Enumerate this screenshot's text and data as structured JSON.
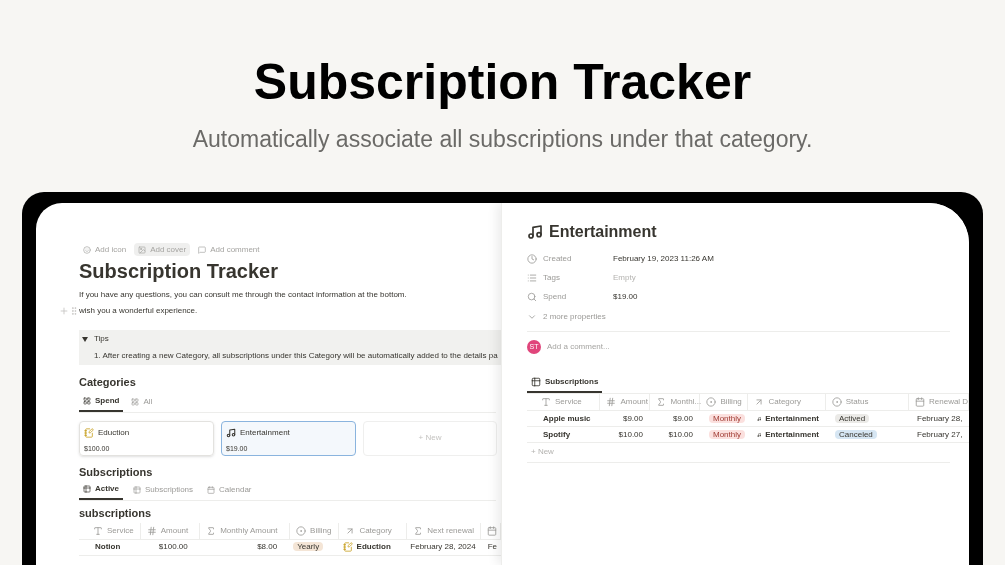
{
  "hero": {
    "title": "Subscription Tracker",
    "subtitle": "Automatically associate all subscriptions under that category."
  },
  "page": {
    "actions": [
      {
        "label": "Add icon",
        "kind": "icon",
        "selected": false
      },
      {
        "label": "Add cover",
        "kind": "cover",
        "selected": true
      },
      {
        "label": "Add comment",
        "kind": "comment",
        "selected": false
      }
    ],
    "title": "Subscription Tracker",
    "paragraphs": [
      "If you have any questions, you can consult me through the contact information at the bottom.",
      "wish you a wonderful experience."
    ],
    "toggle": {
      "label": "Tips",
      "expanded": true,
      "content": "1. After creating a new Category, all subscriptions under this Category will be automatically added to the details pa"
    },
    "categories": {
      "heading": "Categories",
      "views": [
        {
          "label": "Spend",
          "selected": true
        },
        {
          "label": "All",
          "selected": false
        }
      ],
      "cards": [
        {
          "name": "Eduction",
          "kind": "memo",
          "amount": "$100.00",
          "selected": false
        },
        {
          "name": "Entertainment",
          "kind": "music",
          "amount": "$19.00",
          "selected": true
        }
      ],
      "new_label": "+ New"
    },
    "subscriptions": {
      "heading": "Subscriptions",
      "views": [
        {
          "label": "Active",
          "kind": "table",
          "selected": true
        },
        {
          "label": "Subscriptions",
          "kind": "table",
          "selected": false
        },
        {
          "label": "Calendar",
          "kind": "calendar",
          "selected": false
        }
      ],
      "table_title": "subscriptions",
      "columns": [
        {
          "label": "Service",
          "kind": "text"
        },
        {
          "label": "Amount",
          "kind": "number"
        },
        {
          "label": "Monthly Amount",
          "kind": "formula"
        },
        {
          "label": "Billing",
          "kind": "select"
        },
        {
          "label": "Category",
          "kind": "relation"
        },
        {
          "label": "Next renewal",
          "kind": "formula"
        },
        {
          "kind": "date"
        }
      ],
      "rows": [
        {
          "service": "Notion",
          "amount": "$100.00",
          "monthly": "$8.00",
          "billing": {
            "label": "Yearly",
            "color": "#f4e5d6"
          },
          "category": {
            "name": "Eduction",
            "kind": "memo"
          },
          "next_renewal": "February 28, 2024",
          "column_7": "Fe"
        }
      ]
    }
  },
  "detail": {
    "kind": "music",
    "title": "Entertainment",
    "properties": [
      {
        "kind": "date",
        "name": "Created",
        "value": "February 19, 2023 11:26 AM",
        "empty": false
      },
      {
        "kind": "multi",
        "name": "Tags",
        "value": "Empty",
        "empty": true
      },
      {
        "kind": "rollup",
        "name": "Spend",
        "value": "$19.00",
        "empty": false
      }
    ],
    "more": "2 more properties",
    "comment": {
      "avatar": "ST",
      "placeholder": "Add a comment..."
    },
    "view": {
      "label": "Subscriptions",
      "selected": true
    },
    "columns": [
      {
        "label": "Service",
        "kind": "text"
      },
      {
        "label": "Amount",
        "kind": "number"
      },
      {
        "label": "Monthl...",
        "kind": "formula"
      },
      {
        "label": "Billing",
        "kind": "select"
      },
      {
        "label": "Category",
        "kind": "relation"
      },
      {
        "label": "Status",
        "kind": "select"
      },
      {
        "label": "Renewal D",
        "kind": "date"
      }
    ],
    "rows": [
      {
        "service": "Apple music",
        "amount": "$9.00",
        "monthly": "$9.00",
        "billing": {
          "label": "Monthly",
          "color": "#fbe0de"
        },
        "category": {
          "name": "Entertainment",
          "kind": "music"
        },
        "status": {
          "label": "Actived",
          "color": "#ebeae7"
        },
        "renewal": "February 28,"
      },
      {
        "service": "Spotify",
        "amount": "$10.00",
        "monthly": "$10.00",
        "billing": {
          "label": "Monthly",
          "color": "#fbe0de"
        },
        "category": {
          "name": "Entertainment",
          "kind": "music"
        },
        "status": {
          "label": "Canceled",
          "color": "#d6e6f3"
        },
        "renewal": "February 27,"
      }
    ],
    "new_label": "+ New"
  }
}
